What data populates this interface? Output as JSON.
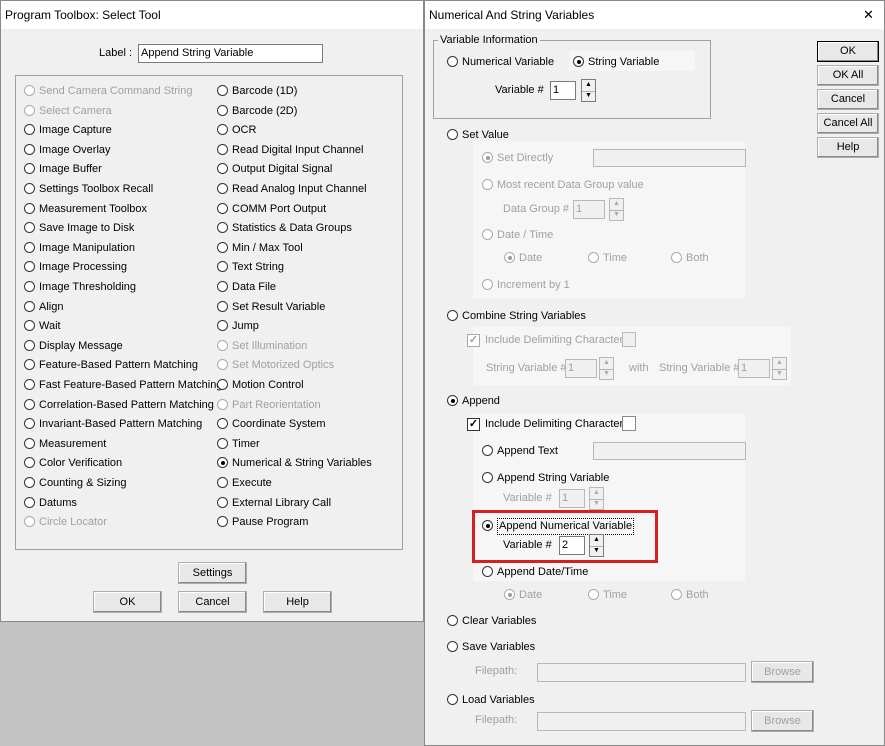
{
  "left_window": {
    "title": "Program Toolbox: Select Tool",
    "label_caption": "Label :",
    "label_value": "Append String Variable",
    "col1": [
      {
        "label": "Send Camera Command String",
        "disabled": true,
        "selected": false
      },
      {
        "label": "Select Camera",
        "disabled": true,
        "selected": false
      },
      {
        "label": "Image Capture",
        "disabled": false,
        "selected": false
      },
      {
        "label": "Image Overlay",
        "disabled": false,
        "selected": false
      },
      {
        "label": "Image Buffer",
        "disabled": false,
        "selected": false
      },
      {
        "label": "Settings Toolbox Recall",
        "disabled": false,
        "selected": false
      },
      {
        "label": "Measurement Toolbox",
        "disabled": false,
        "selected": false
      },
      {
        "label": "Save Image to Disk",
        "disabled": false,
        "selected": false
      },
      {
        "label": "Image Manipulation",
        "disabled": false,
        "selected": false
      },
      {
        "label": "Image Processing",
        "disabled": false,
        "selected": false
      },
      {
        "label": "Image Thresholding",
        "disabled": false,
        "selected": false
      },
      {
        "label": "Align",
        "disabled": false,
        "selected": false
      },
      {
        "label": "Wait",
        "disabled": false,
        "selected": false
      },
      {
        "label": "Display Message",
        "disabled": false,
        "selected": false
      },
      {
        "label": "Feature-Based Pattern Matching",
        "disabled": false,
        "selected": false
      },
      {
        "label": "Fast Feature-Based Pattern Matching",
        "disabled": false,
        "selected": false
      },
      {
        "label": "Correlation-Based Pattern Matching",
        "disabled": false,
        "selected": false
      },
      {
        "label": "Invariant-Based Pattern Matching",
        "disabled": false,
        "selected": false
      },
      {
        "label": "Measurement",
        "disabled": false,
        "selected": false
      },
      {
        "label": "Color Verification",
        "disabled": false,
        "selected": false
      },
      {
        "label": "Counting & Sizing",
        "disabled": false,
        "selected": false
      },
      {
        "label": "Datums",
        "disabled": false,
        "selected": false
      },
      {
        "label": "Circle Locator",
        "disabled": true,
        "selected": false
      }
    ],
    "col2": [
      {
        "label": "Barcode (1D)",
        "disabled": false,
        "selected": false
      },
      {
        "label": "Barcode (2D)",
        "disabled": false,
        "selected": false
      },
      {
        "label": "OCR",
        "disabled": false,
        "selected": false
      },
      {
        "label": "Read Digital Input Channel",
        "disabled": false,
        "selected": false
      },
      {
        "label": "Output Digital Signal",
        "disabled": false,
        "selected": false
      },
      {
        "label": "Read Analog Input Channel",
        "disabled": false,
        "selected": false
      },
      {
        "label": "COMM Port Output",
        "disabled": false,
        "selected": false
      },
      {
        "label": "Statistics & Data Groups",
        "disabled": false,
        "selected": false
      },
      {
        "label": "Min / Max Tool",
        "disabled": false,
        "selected": false
      },
      {
        "label": "Text String",
        "disabled": false,
        "selected": false
      },
      {
        "label": "Data File",
        "disabled": false,
        "selected": false
      },
      {
        "label": "Set Result Variable",
        "disabled": false,
        "selected": false
      },
      {
        "label": "Jump",
        "disabled": false,
        "selected": false
      },
      {
        "label": "Set Illumination",
        "disabled": true,
        "selected": false
      },
      {
        "label": "Set Motorized Optics",
        "disabled": true,
        "selected": false
      },
      {
        "label": "Motion Control",
        "disabled": false,
        "selected": false
      },
      {
        "label": "Part Reorientation",
        "disabled": true,
        "selected": false
      },
      {
        "label": "Coordinate System",
        "disabled": false,
        "selected": false
      },
      {
        "label": "Timer",
        "disabled": false,
        "selected": false
      },
      {
        "label": "Numerical & String Variables",
        "disabled": false,
        "selected": true
      },
      {
        "label": "Execute",
        "disabled": false,
        "selected": false
      },
      {
        "label": "External Library Call",
        "disabled": false,
        "selected": false
      },
      {
        "label": "Pause Program",
        "disabled": false,
        "selected": false
      }
    ],
    "settings_button": "Settings",
    "ok_button": "OK",
    "cancel_button": "Cancel",
    "help_button": "Help"
  },
  "right_window": {
    "title": "Numerical And String Variables",
    "close_glyph": "✕",
    "buttons": {
      "ok": "OK",
      "ok_all": "OK All",
      "cancel": "Cancel",
      "cancel_all": "Cancel All",
      "help": "Help"
    },
    "variable_info": {
      "legend": "Variable Information",
      "numerical": "Numerical Variable",
      "string": "String Variable",
      "selected": "string",
      "variable_label": "Variable #",
      "variable_value": "1"
    },
    "set_value": {
      "label": "Set Value",
      "set_directly": "Set Directly",
      "most_recent": "Most recent Data Group value",
      "data_group_label": "Data Group #",
      "data_group_value": "1",
      "date_time": "Date / Time",
      "date": "Date",
      "time": "Time",
      "both": "Both",
      "increment": "Increment by 1"
    },
    "combine": {
      "label": "Combine String Variables",
      "include_delim": "Include Delimiting Character",
      "string_var_label": "String Variable #",
      "value1": "1",
      "with": "with",
      "value2": "1"
    },
    "append": {
      "label": "Append",
      "include_delim": "Include Delimiting Character",
      "append_text": "Append Text",
      "append_string_var": "Append String Variable",
      "variable_label": "Variable #",
      "string_var_value": "1",
      "append_numerical_var": "Append Numerical Variable",
      "numerical_var_value": "2",
      "append_datetime": "Append Date/Time",
      "date": "Date",
      "time": "Time",
      "both": "Both"
    },
    "clear": "Clear Variables",
    "save": {
      "label": "Save Variables",
      "filepath": "Filepath:",
      "browse": "Browse"
    },
    "load": {
      "label": "Load Variables",
      "filepath": "Filepath:",
      "browse": "Browse"
    },
    "highlight_color": "#d42020"
  }
}
